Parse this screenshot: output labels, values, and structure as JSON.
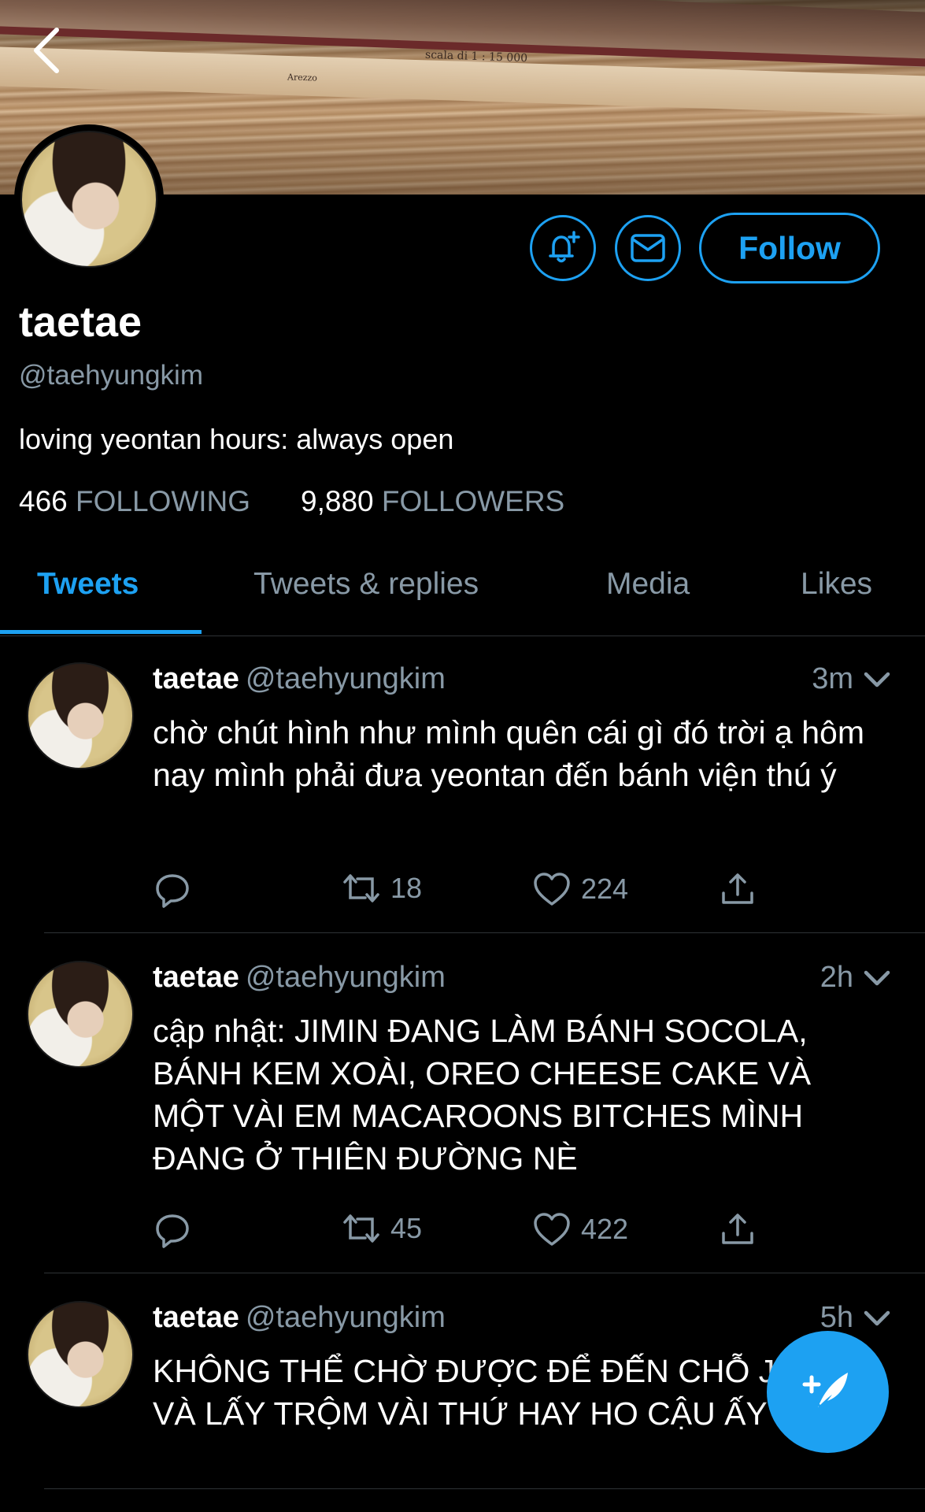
{
  "profile": {
    "name": "taetae",
    "handle": "@taehyungkim",
    "bio": "loving yeontan hours: always open",
    "following_count": "466",
    "following_label": "FOLLOWING",
    "followers_count": "9,880",
    "followers_label": "FOLLOWERS"
  },
  "banner": {
    "text_1": "scala di 1 : 15 000",
    "text_2": "Arezzo"
  },
  "actions": {
    "follow_label": "Follow",
    "notify_icon": "bell-plus-icon",
    "message_icon": "envelope-icon"
  },
  "tabs": [
    {
      "label": "Tweets",
      "active": true
    },
    {
      "label": "Tweets & replies",
      "active": false
    },
    {
      "label": "Media",
      "active": false
    },
    {
      "label": "Likes",
      "active": false
    }
  ],
  "tweets": [
    {
      "name": "taetae",
      "handle": "@taehyungkim",
      "time": "3m",
      "text": "chờ chút hình như mình quên cái gì đó trời ạ hôm nay mình phải đưa yeontan đến bánh viện thú ý",
      "retweets": "18",
      "likes": "224"
    },
    {
      "name": "taetae",
      "handle": "@taehyungkim",
      "time": "2h",
      "text": "cập nhật: JIMIN ĐANG LÀM BÁNH SOCOLA, BÁNH KEM XOÀI, OREO CHEESE CAKE VÀ MỘT VÀI EM MACAROONS BITCHES MÌNH ĐANG Ở THIÊN ĐƯỜNG NÈ",
      "retweets": "45",
      "likes": "422"
    },
    {
      "name": "taetae",
      "handle": "@taehyungkim",
      "time": "5h",
      "text": "KHÔNG THỂ CHỜ ĐƯỢC ĐỂ ĐẾN CHỖ JIMIN VÀ LẤY TRỘM VÀI THỨ HAY HO CẬU ẤY"
    }
  ],
  "colors": {
    "accent": "#1da1f2",
    "muted": "#8899a6",
    "background": "#000000"
  }
}
